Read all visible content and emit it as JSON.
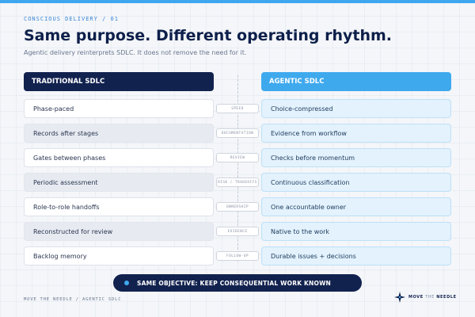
{
  "header": {
    "eyebrow": "CONSCIOUS DELIVERY / 01",
    "title": "Same purpose. Different operating rhythm.",
    "subtitle": "Agentic delivery reinterprets SDLC. It does not remove the need for it."
  },
  "columns": {
    "left_heading": "TRADITIONAL SDLC",
    "right_heading": "AGENTIC SDLC"
  },
  "rows": [
    {
      "left": "Phase-paced",
      "chip": "SPEED",
      "right": "Choice-compressed"
    },
    {
      "left": "Records after stages",
      "chip": "DOCUMENTATION",
      "right": "Evidence from workflow"
    },
    {
      "left": "Gates between phases",
      "chip": "REVIEW",
      "right": "Checks before momentum"
    },
    {
      "left": "Periodic assessment",
      "chip": "RISK / TRADEOFFS",
      "right": "Continuous classification"
    },
    {
      "left": "Role-to-role handoffs",
      "chip": "OWNERSHIP",
      "right": "One accountable owner"
    },
    {
      "left": "Reconstructed for review",
      "chip": "EVIDENCE",
      "right": "Native to the work"
    },
    {
      "left": "Backlog memory",
      "chip": "FOLLOW-UP",
      "right": "Durable issues + decisions"
    }
  ],
  "banner": {
    "text": "SAME OBJECTIVE: KEEP CONSEQUENTIAL WORK KNOWN"
  },
  "footer": {
    "left": "MOVE THE NEEDLE / AGENTIC SDLC",
    "brand_strong": "MOVE",
    "brand_thin": "THE",
    "brand_end": "NEEDLE"
  },
  "colors": {
    "accent": "#3fa9ee",
    "navy": "#12224f",
    "background": "#f4f6f9"
  },
  "icons": {
    "brand": "star-icon",
    "banner": "dot-icon"
  }
}
